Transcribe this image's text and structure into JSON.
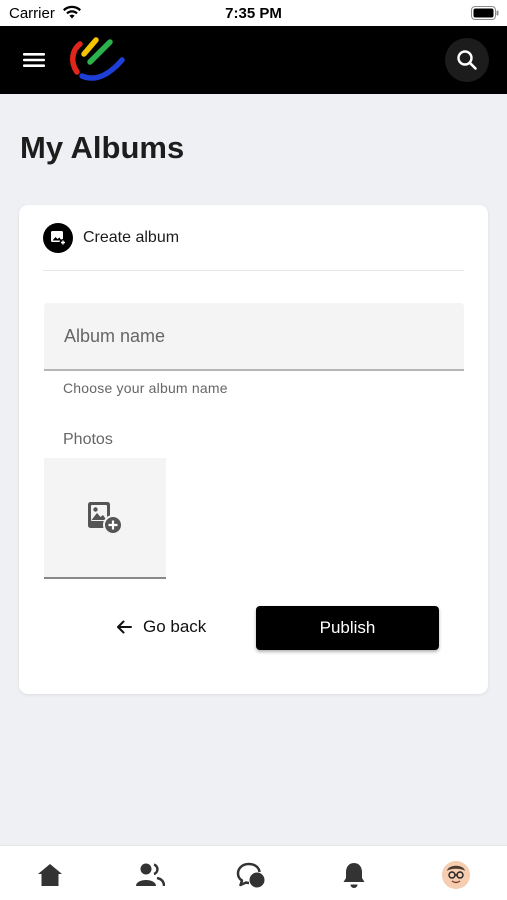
{
  "status_bar": {
    "carrier": "Carrier",
    "time": "7:35 PM"
  },
  "header": {
    "logo_colors": [
      "#e0251b",
      "#f5c400",
      "#2bb24c",
      "#1e3fd6"
    ]
  },
  "page": {
    "title": "My Albums"
  },
  "card": {
    "title": "Create album",
    "album_name": {
      "placeholder": "Album name",
      "value": "",
      "helper": "Choose your album name"
    },
    "photos_label": "Photos",
    "go_back_label": "Go back",
    "publish_label": "Publish"
  },
  "bottom_nav": {
    "items": [
      {
        "icon": "home-icon"
      },
      {
        "icon": "friends-icon"
      },
      {
        "icon": "chat-icon"
      },
      {
        "icon": "notifications-icon"
      },
      {
        "icon": "profile-avatar"
      }
    ]
  },
  "colors": {
    "header_bg": "#000000",
    "page_bg": "#eef0f3",
    "primary_button": "#000000"
  }
}
